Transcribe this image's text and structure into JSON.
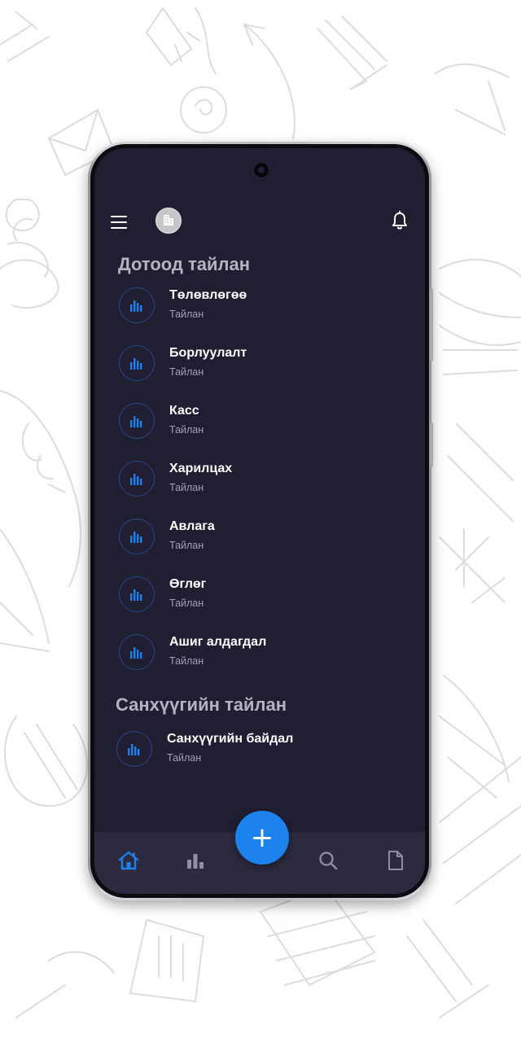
{
  "colors": {
    "screen_background": "#201e31",
    "accent": "#1b82ee",
    "bottom_nav_background": "#2c2a3f",
    "title_text": "#ffffff",
    "subtitle_text": "#a2a2b1",
    "section_header_text": "#b4b4c0"
  },
  "header": {
    "icons": [
      "menu-icon",
      "company-building-icon",
      "bell-icon"
    ]
  },
  "sections": [
    {
      "title": "Дотоод тайлан",
      "items": [
        {
          "title": "Төлөвлөгөө",
          "subtitle": "Тайлан",
          "icon": "bar-chart-icon"
        },
        {
          "title": "Борлуулалт",
          "subtitle": "Тайлан",
          "icon": "bar-chart-icon"
        },
        {
          "title": "Касс",
          "subtitle": "Тайлан",
          "icon": "bar-chart-icon"
        },
        {
          "title": "Харилцах",
          "subtitle": "Тайлан",
          "icon": "bar-chart-icon"
        },
        {
          "title": "Авлага",
          "subtitle": "Тайлан",
          "icon": "bar-chart-icon"
        },
        {
          "title": "Өглөг",
          "subtitle": "Тайлан",
          "icon": "bar-chart-icon"
        },
        {
          "title": "Ашиг алдагдал",
          "subtitle": "Тайлан",
          "icon": "bar-chart-icon"
        }
      ]
    },
    {
      "title": "Санхүүгийн тайлан",
      "items": [
        {
          "title": "Санхүүгийн байдал",
          "subtitle": "Тайлан",
          "icon": "bar-chart-icon"
        }
      ]
    }
  ],
  "bottom_nav": {
    "items": [
      {
        "icon": "home-icon",
        "active": true
      },
      {
        "icon": "bar-chart-icon",
        "active": false
      },
      {
        "icon": "search-icon",
        "active": false
      },
      {
        "icon": "document-icon",
        "active": false
      }
    ],
    "fab": {
      "label": "+",
      "icon": "plus-icon"
    }
  }
}
